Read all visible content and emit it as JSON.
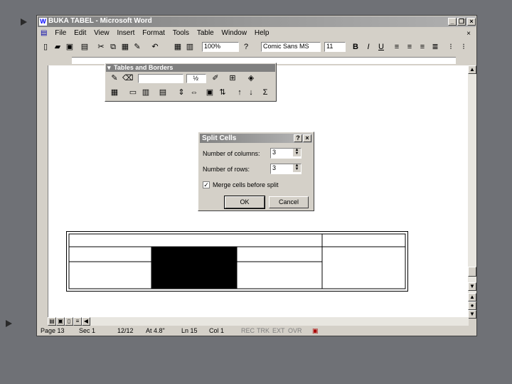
{
  "window": {
    "title": "BUKA TABEL - Microsoft Word",
    "controls": [
      "_",
      "❐",
      "×"
    ]
  },
  "menu": [
    "File",
    "Edit",
    "View",
    "Insert",
    "Format",
    "Tools",
    "Table",
    "Window",
    "Help"
  ],
  "toolbar": {
    "zoom": "100%",
    "font": "Comic Sans MS",
    "size": "11",
    "bold": "B",
    "italic": "I",
    "underline": "U"
  },
  "tables_toolbar": {
    "title": "Tables and Borders",
    "line_weight": "½"
  },
  "split_dialog": {
    "title": "Split Cells",
    "columns_label": "Number of columns:",
    "columns_value": "3",
    "rows_label": "Number of rows:",
    "rows_value": "3",
    "merge_label": "Merge cells before split",
    "merge_checked": true,
    "ok": "OK",
    "cancel": "Cancel"
  },
  "status_bar": {
    "page": "Page 13",
    "sec": "Sec 1",
    "pages": "12/12",
    "at": "At 4.8\"",
    "ln": "Ln 15",
    "col": "Col 1",
    "rec": "REC",
    "trk": "TRK",
    "ext": "EXT",
    "ovr": "OVR"
  },
  "colors": {
    "desktop": "#6f7176",
    "face": "#d4d0c8",
    "selected_cell": "#000000"
  }
}
